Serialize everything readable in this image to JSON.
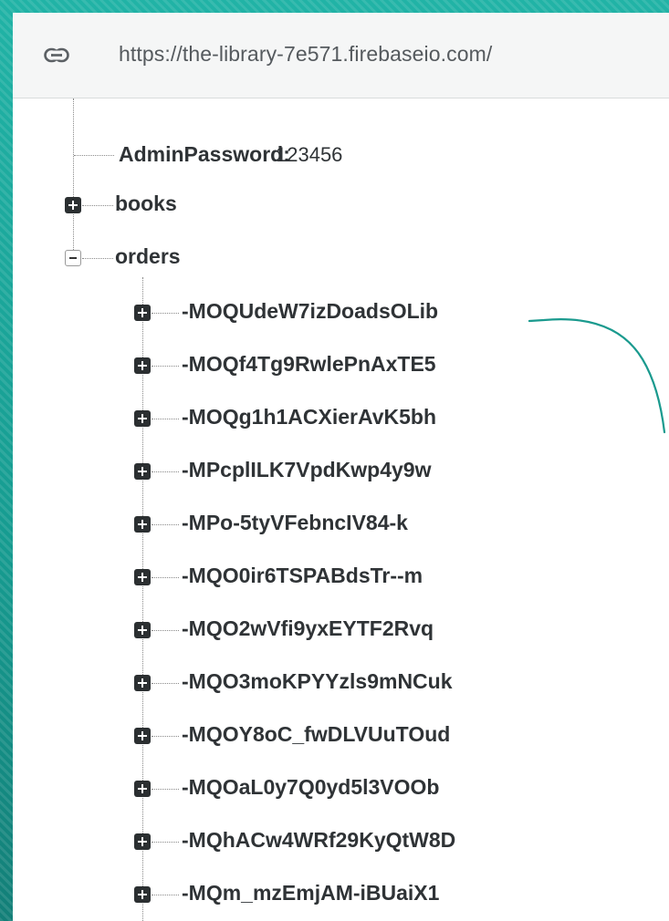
{
  "url_bar": {
    "icon": "link-icon",
    "url": "https://the-library-7e571.firebaseio.com/"
  },
  "tree": {
    "admin_password": {
      "key": "AdminPassword:",
      "value": "123456"
    },
    "books": {
      "key": "books",
      "toggle": "expand"
    },
    "orders": {
      "key": "orders",
      "toggle": "collapse",
      "children": [
        "-MOQUdeW7izDoadsOLib",
        "-MOQf4Tg9RwlePnAxTE5",
        "-MOQg1h1ACXierAvK5bh",
        "-MPcplILK7VpdKwp4y9w",
        "-MPo-5tyVFebncIV84-k",
        "-MQO0ir6TSPABdsTr--m",
        "-MQO2wVfi9yxEYTF2Rvq",
        "-MQO3moKPYYzls9mNCuk",
        "-MQOY8oC_fwDLVUuTOud",
        "-MQOaL0y7Q0yd5l3VOOb",
        "-MQhACw4WRf29KyQtW8D",
        "-MQm_mzEmjAM-iBUaiX1"
      ]
    }
  },
  "colors": {
    "frame": "#1aa79c",
    "annotation": "#1a9a8e",
    "text": "#2f3336"
  }
}
